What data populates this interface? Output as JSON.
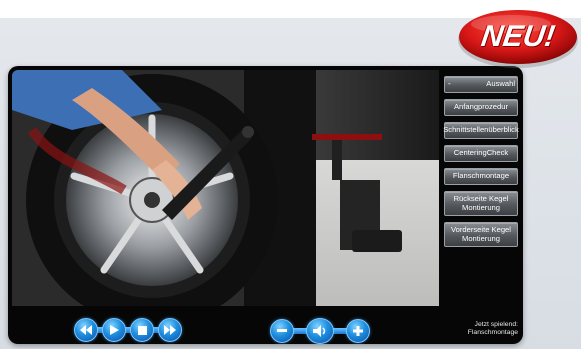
{
  "badge": {
    "label": "NEU!"
  },
  "menu": {
    "items": [
      {
        "label": "Auswahl",
        "collapse_sign": "-"
      },
      {
        "label": "Anfangprozedur"
      },
      {
        "label": "Schnittstellenüberblick"
      },
      {
        "label": "CenteringCheck"
      },
      {
        "label": "Flanschmontage"
      },
      {
        "label": "Rückseite Kegel Montierung"
      },
      {
        "label": "Vorderseite Kegel Montierung"
      }
    ]
  },
  "now_playing": {
    "label": "Jetzt spielend:",
    "title": "Flanschmontage"
  },
  "controls": {
    "icons": [
      "rewind-icon",
      "play-icon",
      "stop-icon",
      "fast-forward-icon",
      "volume-down-icon",
      "speaker-icon",
      "volume-up-icon"
    ]
  },
  "colors": {
    "accent": "#1f8fe0",
    "badge": "#d81818",
    "player_bg": "#060606"
  }
}
